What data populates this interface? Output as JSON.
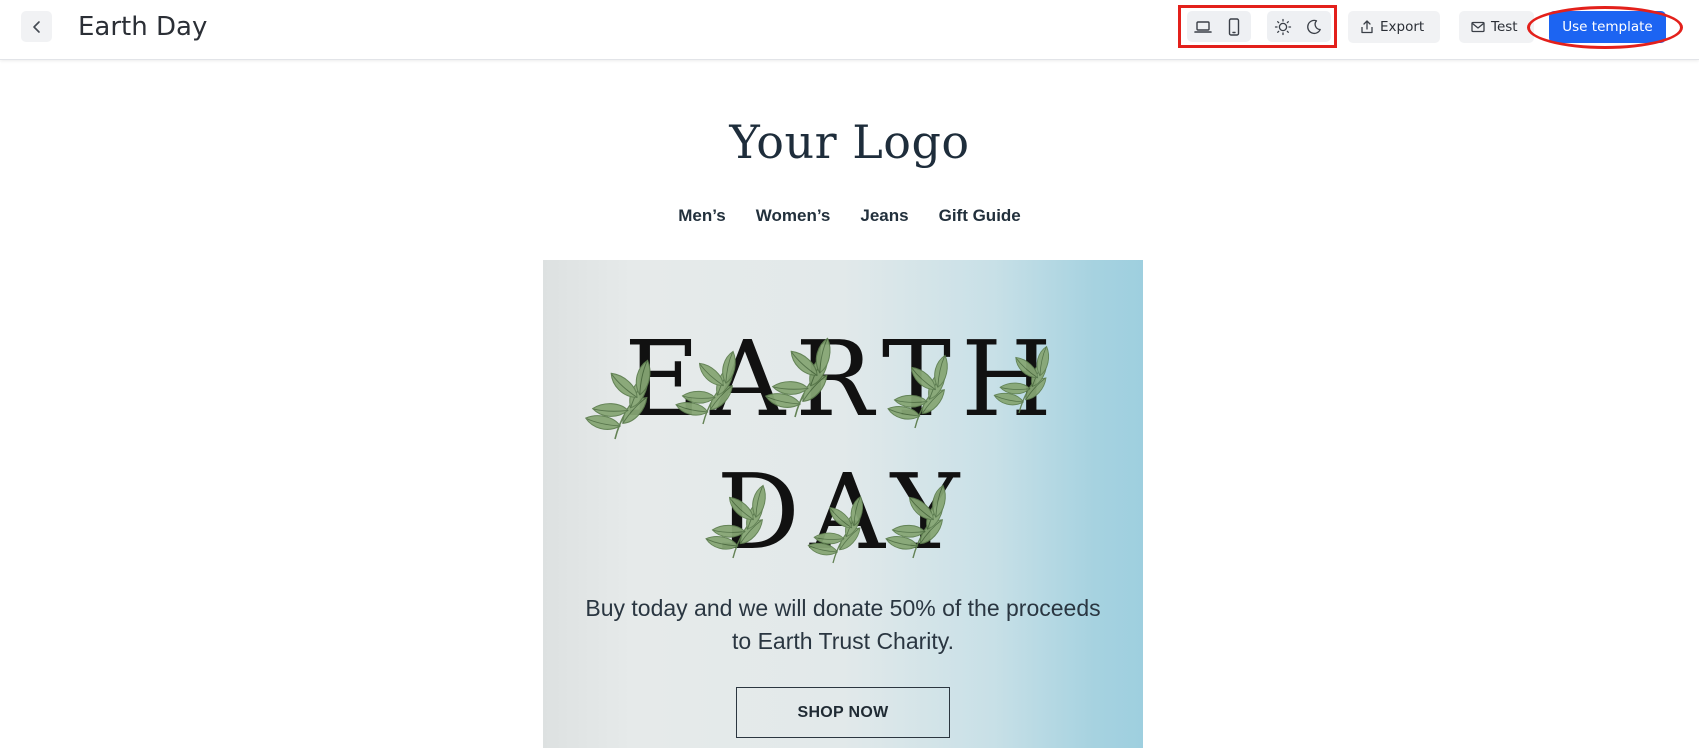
{
  "header": {
    "title": "Earth Day",
    "export_label": "Export",
    "test_label": "Test",
    "use_template_label": "Use template"
  },
  "email": {
    "logo_text": "Your Logo",
    "nav": [
      "Men’s",
      "Women’s",
      "Jeans",
      "Gift Guide"
    ],
    "hero": {
      "headline_line1": "EARTH",
      "headline_line2": "DAY",
      "body": "Buy today and we will donate 50% of the proceeds to Earth Trust Charity.",
      "cta": "SHOP NOW"
    }
  },
  "colors": {
    "primary_button": "#1c64f2",
    "annotation_red": "#e3201b",
    "leaf_green": "#7f9f6d"
  }
}
